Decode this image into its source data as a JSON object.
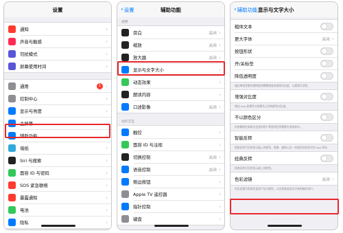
{
  "screens": {
    "settings": {
      "title": "设置",
      "groups": [
        [
          {
            "label": "通知",
            "icon": "bell-icon",
            "color": "#ff3b30"
          },
          {
            "label": "声音与触感",
            "icon": "speaker-icon",
            "color": "#ff2d55"
          },
          {
            "label": "勿扰模式",
            "icon": "moon-icon",
            "color": "#5856d6"
          },
          {
            "label": "屏幕使用时间",
            "icon": "hourglass-icon",
            "color": "#5856d6"
          }
        ],
        [
          {
            "label": "通用",
            "icon": "gear-icon",
            "color": "#8e8e93",
            "badge": "1"
          },
          {
            "label": "控制中心",
            "icon": "switches-icon",
            "color": "#8e8e93"
          },
          {
            "label": "显示与亮度",
            "icon": "brightness-icon",
            "color": "#007aff"
          },
          {
            "label": "主屏幕",
            "icon": "home-screen-icon",
            "color": "#007aff"
          },
          {
            "label": "辅助功能",
            "icon": "accessibility-icon",
            "color": "#007aff"
          },
          {
            "label": "墙纸",
            "icon": "wallpaper-icon",
            "color": "#34aadc"
          },
          {
            "label": "Siri 与搜索",
            "icon": "siri-icon",
            "color": "#222222"
          },
          {
            "label": "面容 ID 与密码",
            "icon": "face-id-icon",
            "color": "#34c759"
          },
          {
            "label": "SOS 紧急联络",
            "icon": "sos-icon",
            "color": "#ff3b30"
          },
          {
            "label": "暴露通知",
            "icon": "exposure-icon",
            "color": "#ff3b30"
          },
          {
            "label": "电池",
            "icon": "battery-icon",
            "color": "#34c759"
          },
          {
            "label": "隐私",
            "icon": "hand-icon",
            "color": "#007aff"
          }
        ]
      ]
    },
    "accessibility": {
      "back": "设置",
      "title": "辅助功能",
      "vision_header": "视觉",
      "vision_items": [
        {
          "label": "旁白",
          "icon": "voiceover-icon",
          "color": "#222222",
          "value": "关闭"
        },
        {
          "label": "缩放",
          "icon": "zoom-icon",
          "color": "#222222",
          "value": "关闭"
        },
        {
          "label": "放大器",
          "icon": "magnifier-icon",
          "color": "#222222",
          "value": "关闭"
        },
        {
          "label": "显示与文字大小",
          "icon": "text-size-icon",
          "color": "#007aff"
        },
        {
          "label": "动态效果",
          "icon": "motion-icon",
          "color": "#34c759"
        },
        {
          "label": "朗读内容",
          "icon": "speech-icon",
          "color": "#222222"
        },
        {
          "label": "口述影像",
          "icon": "audio-description-icon",
          "color": "#007aff",
          "value": "关闭"
        }
      ],
      "physical_header": "动作交互",
      "physical_items": [
        {
          "label": "触控",
          "icon": "touch-icon",
          "color": "#007aff"
        },
        {
          "label": "面容 ID 与注视",
          "icon": "face-id-icon",
          "color": "#34c759"
        },
        {
          "label": "切换控制",
          "icon": "switch-control-icon",
          "color": "#222222",
          "value": "关闭"
        },
        {
          "label": "语音控制",
          "icon": "voice-control-icon",
          "color": "#007aff",
          "value": "关闭"
        },
        {
          "label": "侧边按钮",
          "icon": "side-button-icon",
          "color": "#007aff"
        },
        {
          "label": "Apple TV 遥控器",
          "icon": "remote-icon",
          "color": "#8e8e93"
        },
        {
          "label": "指针控制",
          "icon": "pointer-icon",
          "color": "#007aff"
        },
        {
          "label": "键盘",
          "icon": "keyboard-icon",
          "color": "#8e8e93"
        }
      ]
    },
    "display_text": {
      "back": "辅助功能",
      "title": "显示与文字大小",
      "items": [
        {
          "label": "粗体文本",
          "type": "toggle",
          "on": false
        },
        {
          "label": "更大字体",
          "type": "link",
          "value": "关闭"
        },
        {
          "label": "按钮形状",
          "type": "toggle",
          "on": false
        },
        {
          "label": "开/关标签",
          "type": "toggle",
          "on": false
        },
        {
          "label": "降低透明度",
          "type": "toggle",
          "on": false,
          "footnote": "通过降低背景的透明度和模糊程度来提高对比度，以提高可读性。"
        },
        {
          "label": "增强对比度",
          "type": "toggle",
          "on": false,
          "footnote": "增加 App 前景色与背景色之间的颜色对比度。"
        },
        {
          "label": "不以颜色区分",
          "type": "toggle",
          "on": false,
          "footnote": "仅依赖颜色来表达信息的用户界面项目将替换为其他样式。"
        },
        {
          "label": "智能反转",
          "type": "toggle",
          "on": false,
          "footnote": "智能反转可反转显示器上的颜色，图像、媒体以及一些使用深色样式的 App 除外。"
        },
        {
          "label": "经典反转",
          "type": "toggle",
          "on": false,
          "footnote": "经典反转可反转显示器上的颜色。"
        },
        {
          "label": "色彩滤镜",
          "type": "link",
          "value": "关闭",
          "footnote": "色彩滤镜可帮助色盲用户区分颜色，以及帮助阅读文字有困难的用户。"
        }
      ]
    }
  },
  "highlight_color": "#e8262b"
}
